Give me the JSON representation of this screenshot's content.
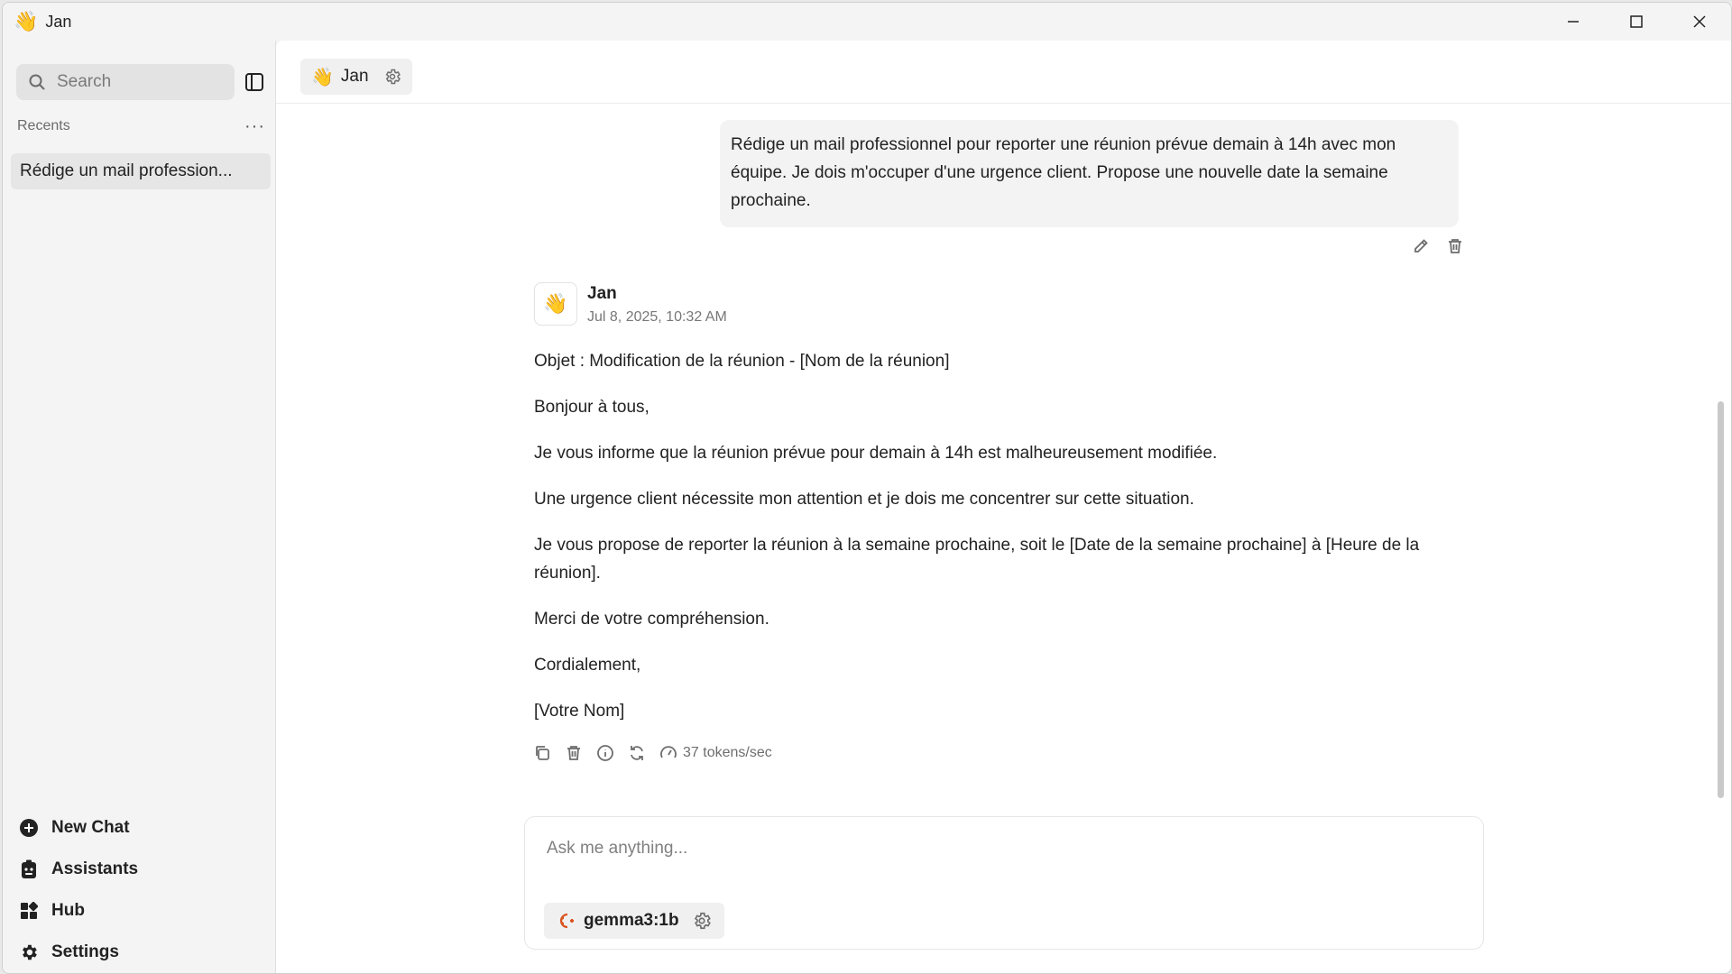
{
  "window": {
    "title": "Jan",
    "icon": "waving-hand-emoji",
    "icon_glyph": "👋"
  },
  "sidebar": {
    "search_placeholder": "Search",
    "recents_label": "Recents",
    "recents_more": "···",
    "recent_items": [
      {
        "label": "Rédige un mail profession..."
      }
    ],
    "nav": [
      {
        "label": "New Chat",
        "icon": "plus-circle-icon"
      },
      {
        "label": "Assistants",
        "icon": "assistant-icon"
      },
      {
        "label": "Hub",
        "icon": "grid-icon"
      },
      {
        "label": "Settings",
        "icon": "gear-icon"
      }
    ]
  },
  "header": {
    "assistant_emoji": "👋",
    "assistant_name": "Jan"
  },
  "conversation": {
    "user_message": "Rédige un mail professionnel pour reporter une réunion prévue demain à 14h avec mon équipe. Je dois m'occuper d'une urgence client. Propose une nouvelle date la semaine prochaine.",
    "bot": {
      "avatar_emoji": "👋",
      "name": "Jan",
      "timestamp": "Jul 8, 2025, 10:32 AM",
      "paragraphs": [
        "Objet : Modification de la réunion - [Nom de la réunion]",
        "Bonjour à tous,",
        "Je vous informe que la réunion prévue pour demain à 14h est malheureusement modifiée.",
        "Une urgence client nécessite mon attention et je dois me concentrer sur cette situation.",
        "Je vous propose de reporter la réunion à la semaine prochaine, soit le [Date de la semaine prochaine] à [Heure de la réunion].",
        "Merci de votre compréhension.",
        "Cordialement,",
        "[Votre Nom]"
      ],
      "tokens_speed": "37 tokens/sec"
    }
  },
  "composer": {
    "placeholder": "Ask me anything...",
    "model_name": "gemma3:1b"
  },
  "colors": {
    "accent_model_icon": "#d9541e",
    "background": "#f4f4f4",
    "main_background": "#ffffff"
  }
}
